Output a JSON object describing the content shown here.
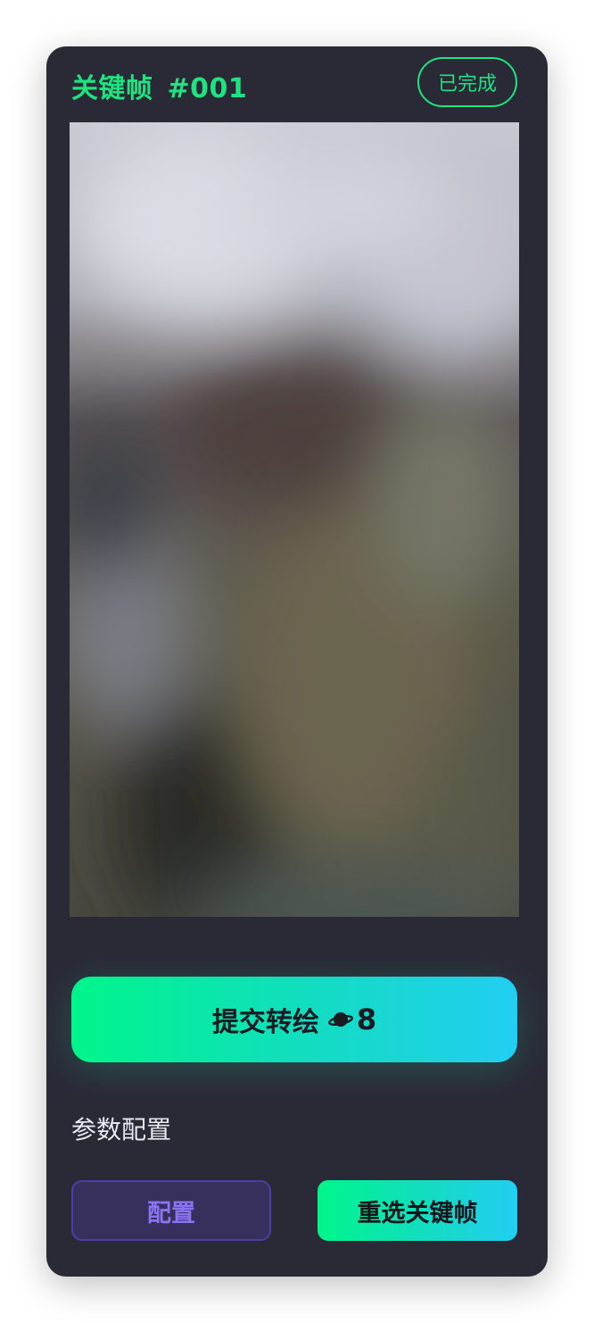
{
  "keyframe": {
    "label": "关键帧",
    "number": "#001",
    "status": "已完成"
  },
  "preview": {
    "blurred": true
  },
  "submit": {
    "label": "提交转绘",
    "coin_icon": "planet-coin-icon",
    "cost": "8"
  },
  "params": {
    "section_label": "参数配置",
    "config_label": "配置",
    "reselect_label": "重选关键帧"
  },
  "colors": {
    "card_bg": "#2a2a37",
    "accent_green": "#1fe37f",
    "gradient_start": "#00f58a",
    "gradient_end": "#22cef2",
    "config_purple": "#8b73f2"
  }
}
